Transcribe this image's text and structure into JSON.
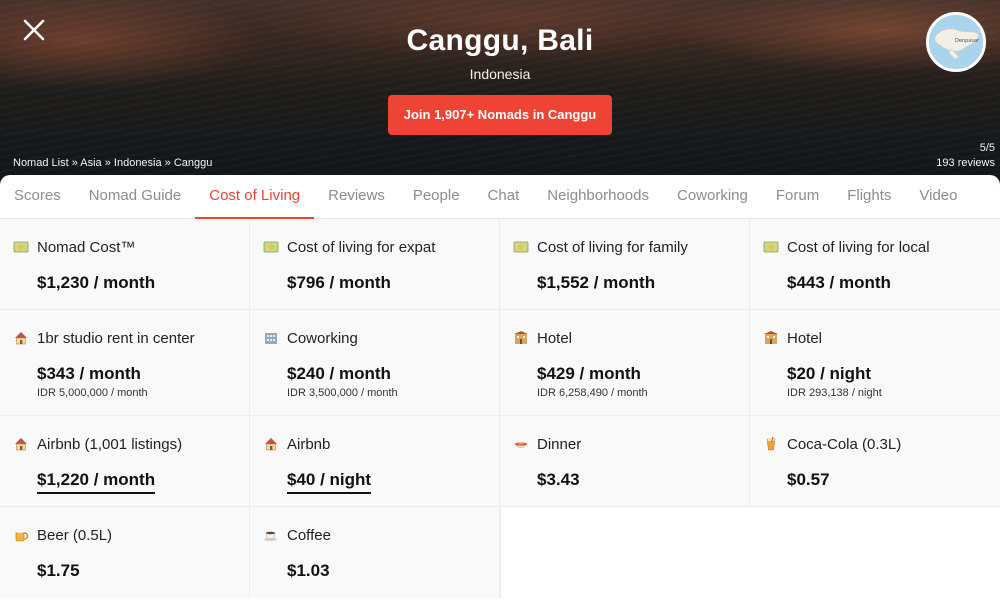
{
  "hero": {
    "title": "Canggu, Bali",
    "country": "Indonesia",
    "join_label": "Join 1,907+ Nomads in Canggu",
    "join_color": "#ef4335",
    "breadcrumb": [
      "Nomad List",
      "Asia",
      "Indonesia",
      "Canggu"
    ],
    "breadcrumb_separator": " » ",
    "rating": "5/5",
    "reviews": "193 reviews",
    "close_icon": "close-icon",
    "map_icon": "map-thumbnail",
    "map_label": "Denpasar"
  },
  "tabs": [
    {
      "label": "Scores",
      "active": false
    },
    {
      "label": "Nomad Guide",
      "active": false
    },
    {
      "label": "Cost of Living",
      "active": true
    },
    {
      "label": "Reviews",
      "active": false
    },
    {
      "label": "People",
      "active": false
    },
    {
      "label": "Chat",
      "active": false
    },
    {
      "label": "Neighborhoods",
      "active": false
    },
    {
      "label": "Coworking",
      "active": false
    },
    {
      "label": "Forum",
      "active": false
    },
    {
      "label": "Flights",
      "active": false
    },
    {
      "label": "Video",
      "active": false
    }
  ],
  "costs": {
    "row1": [
      {
        "icon": "money-icon",
        "label": "Nomad Cost™",
        "value": "$1,230 / month"
      },
      {
        "icon": "money-icon",
        "label": "Cost of living for expat",
        "value": "$796 / month"
      },
      {
        "icon": "money-icon",
        "label": "Cost of living for family",
        "value": "$1,552 / month"
      },
      {
        "icon": "money-icon",
        "label": "Cost of living for local",
        "value": "$443 / month"
      }
    ],
    "row2": [
      {
        "icon": "house-icon",
        "label": "1br studio rent in center",
        "value": "$343 / month",
        "sub": "IDR 5,000,000 / month"
      },
      {
        "icon": "office-building-icon",
        "label": "Coworking",
        "value": "$240 / month",
        "sub": "IDR 3,500,000 / month"
      },
      {
        "icon": "hotel-icon",
        "label": "Hotel",
        "value": "$429 / month",
        "sub": "IDR 6,258,490 / month"
      },
      {
        "icon": "hotel-icon",
        "label": "Hotel",
        "value": "$20 / night",
        "sub": "IDR 293,138 / night"
      }
    ],
    "row3": [
      {
        "icon": "house-icon",
        "label": "Airbnb (1,001 listings)",
        "value": "$1,220 / month"
      },
      {
        "icon": "house-icon",
        "label": "Airbnb",
        "value": "$40 / night"
      },
      {
        "icon": "dinner-bowl-icon",
        "label": "Dinner",
        "value": "$3.43"
      },
      {
        "icon": "cola-glass-icon",
        "label": "Coca-Cola (0.3L)",
        "value": "$0.57"
      }
    ],
    "row4": [
      {
        "icon": "beer-mug-icon",
        "label": "Beer (0.5L)",
        "value": "$1.75"
      },
      {
        "icon": "coffee-cup-icon",
        "label": "Coffee",
        "value": "$1.03"
      }
    ]
  }
}
